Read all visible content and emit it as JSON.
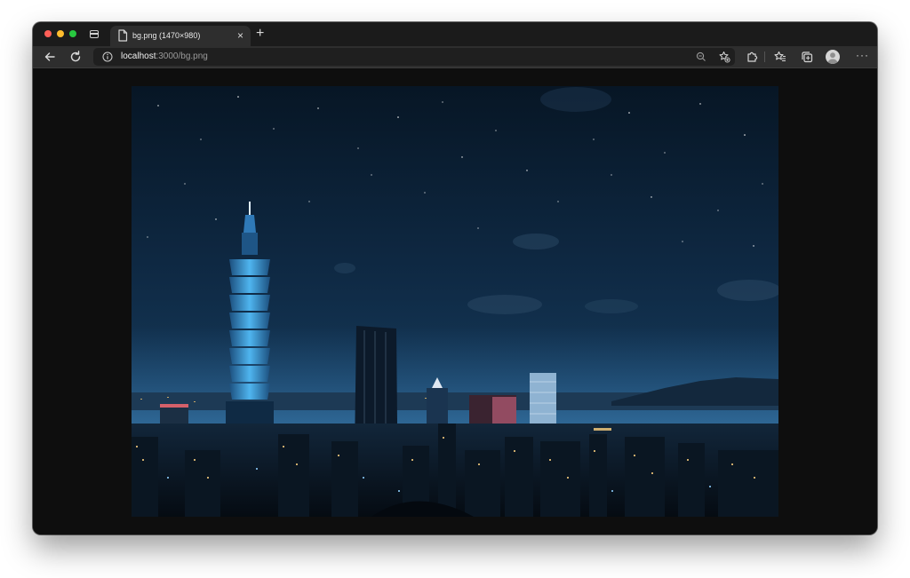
{
  "browser": {
    "tab": {
      "title": "bg.png (1470×980)",
      "close_glyph": "×",
      "icon": "document-icon"
    },
    "new_tab_glyph": "+",
    "toolbar": {
      "back_icon": "arrow-left-icon",
      "reload_icon": "reload-icon",
      "address": {
        "host": "localhost",
        "path": ":3000/bg.png",
        "info_icon": "info-icon"
      },
      "zoom_icon": "zoom-out-icon",
      "favorite_icon": "star-add-icon",
      "extensions_icon": "puzzle-icon",
      "favorites_icon": "favorites-list-icon",
      "collections_icon": "collections-icon",
      "profile_icon": "avatar",
      "more_glyph": "···"
    },
    "colors": {
      "tabbar": "#1b1b1b",
      "toolbar": "#2e2e2e",
      "page_background": "#0e0e0e",
      "traffic_close": "#fe5f57",
      "traffic_minimize": "#febc2e",
      "traffic_maximize": "#28c840"
    }
  },
  "content": {
    "image_description": "Night skyline of a city with a tall illuminated tower under a starry sky",
    "image_name": "bg.png"
  }
}
